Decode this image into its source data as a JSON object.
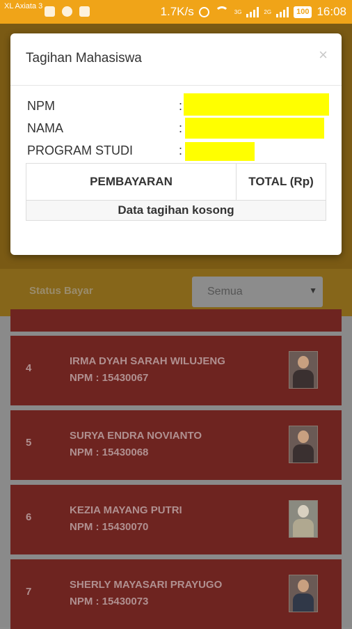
{
  "status_bar": {
    "carrier": "XL Axiata 3",
    "speed": "1.7K/s",
    "network_a": "3G",
    "network_b": "2G",
    "battery": "100",
    "time": "16:08"
  },
  "filter": {
    "label": "Status Bayar",
    "selected": "Semua"
  },
  "students": [
    {
      "no": "4",
      "name": "IRMA DYAH SARAH WILUJENG",
      "npm": "NPM : 15430067"
    },
    {
      "no": "5",
      "name": "SURYA ENDRA NOVIANTO",
      "npm": "NPM : 15430068"
    },
    {
      "no": "6",
      "name": "KEZIA MAYANG PUTRI",
      "npm": "NPM : 15430070"
    },
    {
      "no": "7",
      "name": "SHERLY MAYASARI PRAYUGO",
      "npm": "NPM : 15430073"
    }
  ],
  "modal": {
    "title": "Tagihan Mahasiswa",
    "close": "×",
    "fields": [
      {
        "label": "NPM",
        "colon": ":"
      },
      {
        "label": "NAMA",
        "colon": ":"
      },
      {
        "label": "PROGRAM STUDI",
        "colon": ":"
      }
    ],
    "table": {
      "headers": [
        "PEMBAYARAN",
        "TOTAL (Rp)"
      ],
      "empty": "Data tagihan kosong"
    }
  },
  "colors": {
    "statusbar": "#f0a418",
    "highlight": "#ffff00",
    "card": "#c0392b"
  }
}
